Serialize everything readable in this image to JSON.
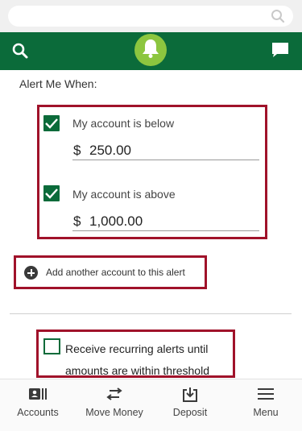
{
  "header": {
    "search_icon": "search-icon",
    "notification_icon": "bell-icon",
    "chat_icon": "chat-icon",
    "accent_color": "#0b6b3a",
    "bell_bg_color": "#8cc63f"
  },
  "alert_section": {
    "heading": "Alert Me When:",
    "conditions": [
      {
        "label": "My account is below",
        "checked": true,
        "currency": "$",
        "amount": "250.00"
      },
      {
        "label": "My account is above",
        "checked": true,
        "currency": "$",
        "amount": "1,000.00"
      }
    ],
    "add_account_label": "Add another account to this alert",
    "recurring": {
      "checked": false,
      "line1": "Receive recurring alerts until",
      "line2": "amounts are within threshold"
    },
    "highlight_color": "#a0122a"
  },
  "bottom_nav": {
    "items": [
      {
        "label": "Accounts",
        "icon": "accounts-icon"
      },
      {
        "label": "Move Money",
        "icon": "transfer-icon"
      },
      {
        "label": "Deposit",
        "icon": "deposit-icon"
      },
      {
        "label": "Menu",
        "icon": "menu-icon"
      }
    ]
  }
}
